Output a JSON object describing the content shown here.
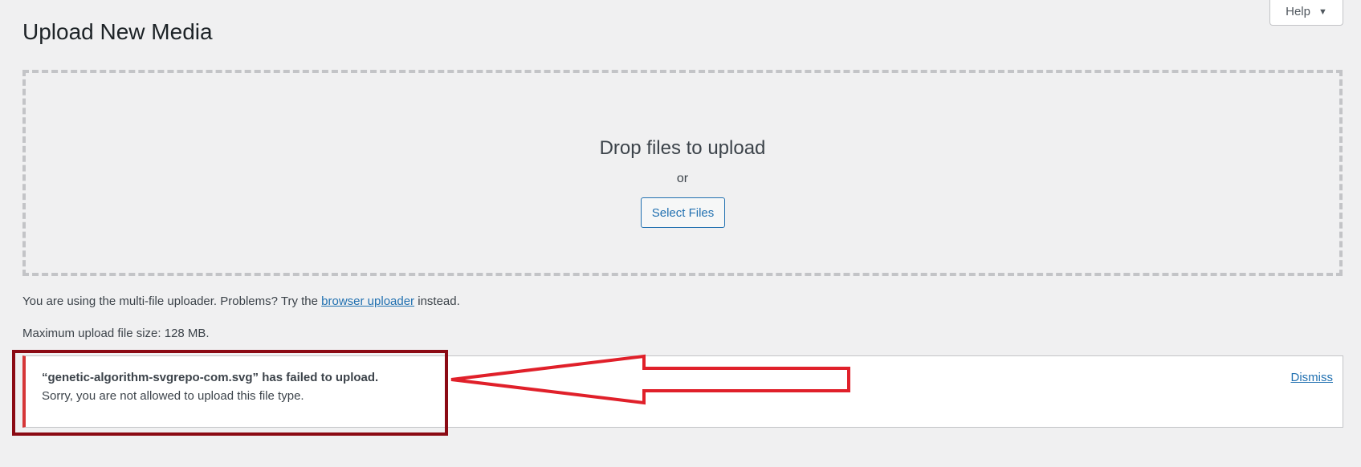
{
  "page": {
    "title": "Upload New Media"
  },
  "help": {
    "label": "Help",
    "caret": "▼"
  },
  "dropzone": {
    "title": "Drop files to upload",
    "or_text": "or",
    "select_button": "Select Files"
  },
  "uploader_info": {
    "prefix": "You are using the multi-file uploader. Problems? Try the",
    "link_text": "browser uploader",
    "suffix": "instead."
  },
  "max_upload": "Maximum upload file size: 128 MB.",
  "error": {
    "filename_line": "“genetic-algorithm-svgrepo-com.svg” has failed to upload.",
    "message": "Sorry, you are not allowed to upload this file type.",
    "dismiss": "Dismiss"
  },
  "colors": {
    "background": "#f0f0f1",
    "link": "#2271b1",
    "error_border": "#d63638",
    "annotation_box": "#8b0a14",
    "annotation_arrow": "#e0202a"
  }
}
